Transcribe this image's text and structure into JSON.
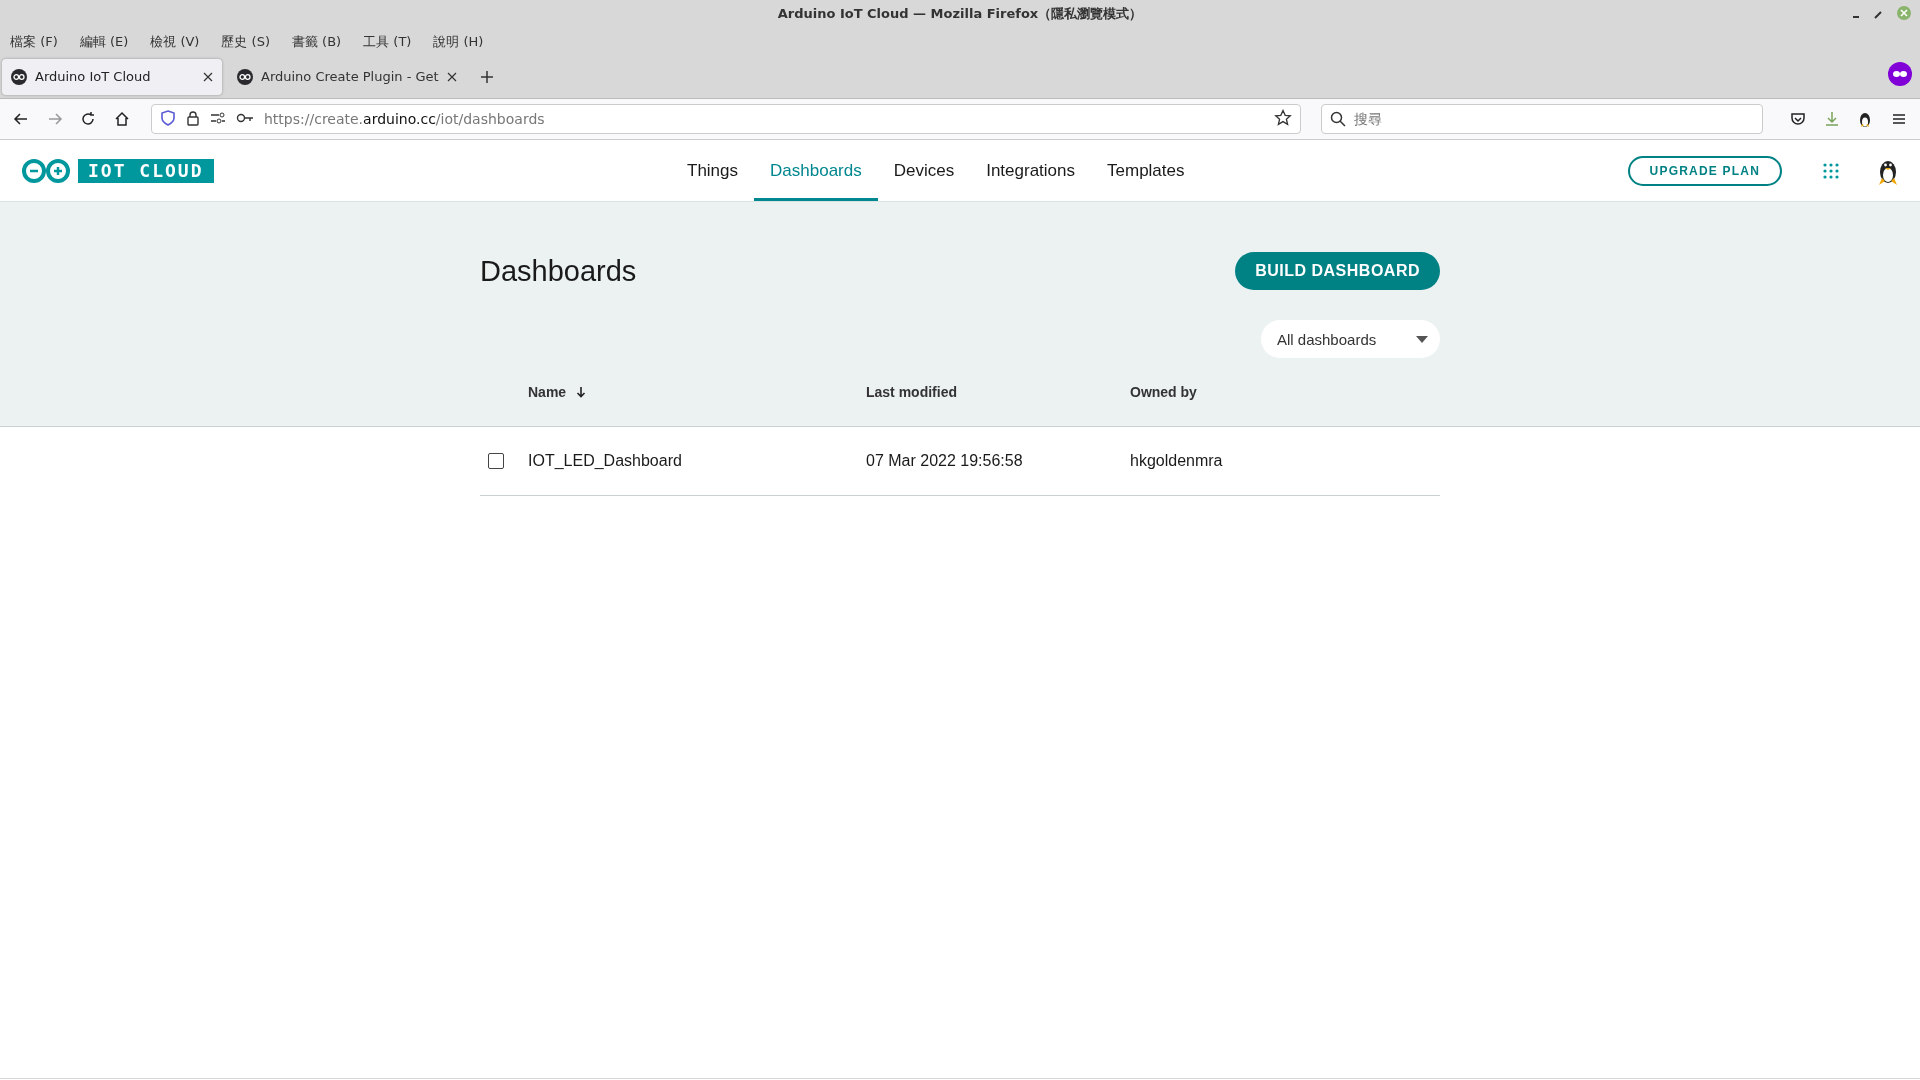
{
  "window": {
    "title": "Arduino IoT Cloud — Mozilla Firefox（隱私瀏覽模式）"
  },
  "menu": [
    "檔案 (F)",
    "編輯 (E)",
    "檢視 (V)",
    "歷史 (S)",
    "書籤 (B)",
    "工具 (T)",
    "說明 (H)"
  ],
  "browser_tabs": [
    {
      "title": "Arduino IoT Cloud",
      "selected": true
    },
    {
      "title": "Arduino Create Plugin - Get",
      "selected": false
    }
  ],
  "address_bar": {
    "url_prefix": "https://create.",
    "url_domain": "arduino.cc",
    "url_path": "/iot/dashboards"
  },
  "search": {
    "placeholder": "搜尋"
  },
  "app": {
    "logo_text": "IOT CLOUD",
    "nav": [
      {
        "label": "Things",
        "selected": false
      },
      {
        "label": "Dashboards",
        "selected": true
      },
      {
        "label": "Devices",
        "selected": false
      },
      {
        "label": "Integrations",
        "selected": false
      },
      {
        "label": "Templates",
        "selected": false
      }
    ],
    "upgrade_button": "UPGRADE PLAN"
  },
  "page": {
    "title": "Dashboards",
    "build_button": "BUILD DASHBOARD",
    "filter": "All dashboards",
    "columns": [
      {
        "label": "Name",
        "sorted": true
      },
      {
        "label": "Last modified",
        "sorted": false
      },
      {
        "label": "Owned by",
        "sorted": false
      }
    ],
    "rows": [
      {
        "checked": false,
        "cells": [
          "IOT_LED_Dashboard",
          "07 Mar 2022 19:56:58",
          "hkgoldenmra"
        ]
      }
    ]
  }
}
